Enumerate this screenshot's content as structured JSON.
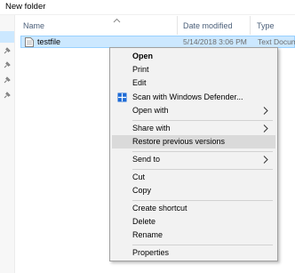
{
  "window": {
    "title": "New folder"
  },
  "columns": {
    "name": "Name",
    "date_modified": "Date modified",
    "type": "Type"
  },
  "file": {
    "name": "testfile",
    "date": "5/14/2018 3:06 PM",
    "type": "Text Docum"
  },
  "menu": {
    "items": [
      {
        "label": "Open",
        "bold": true
      },
      {
        "label": "Print"
      },
      {
        "label": "Edit"
      },
      {
        "label": "Scan with Windows Defender...",
        "icon": "windows-defender-icon"
      },
      {
        "label": "Open with",
        "submenu": true
      },
      {
        "label": "Share with",
        "submenu": true
      },
      {
        "label": "Restore previous versions",
        "highlighted": true
      },
      {
        "label": "Send to",
        "submenu": true
      },
      {
        "label": "Cut"
      },
      {
        "label": "Copy"
      },
      {
        "label": "Create shortcut"
      },
      {
        "label": "Delete"
      },
      {
        "label": "Rename"
      },
      {
        "label": "Properties"
      }
    ]
  },
  "colors": {
    "selection": "#cce8ff",
    "menu_background": "#f2f2f2",
    "menu_hover": "#dadada",
    "defender_blue": "#1e6bd6"
  }
}
